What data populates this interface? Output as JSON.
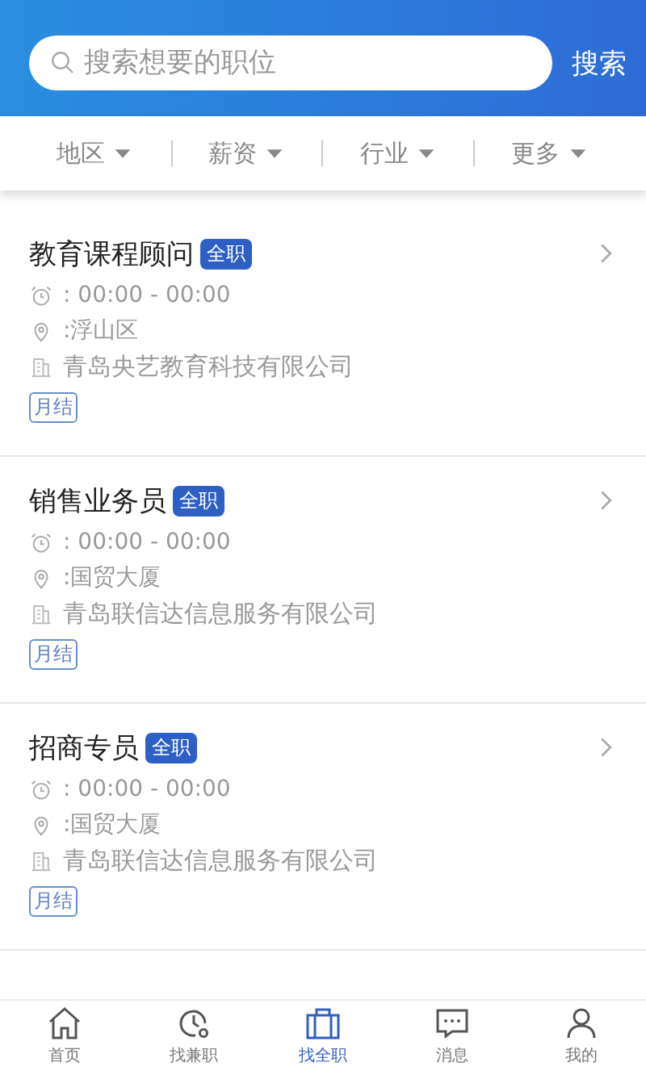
{
  "search": {
    "placeholder": "搜索想要的职位",
    "button": "搜索"
  },
  "filters": [
    {
      "label": "地区"
    },
    {
      "label": "薪资"
    },
    {
      "label": "行业"
    },
    {
      "label": "更多"
    }
  ],
  "jobs": [
    {
      "title": "教育课程顾问",
      "type": "全职",
      "hours": ": 00:00 - 00:00",
      "location": ":浮山区",
      "company": "青岛央艺教育科技有限公司",
      "pay": "月结"
    },
    {
      "title": "销售业务员",
      "type": "全职",
      "hours": ": 00:00 - 00:00",
      "location": ":国贸大厦",
      "company": "青岛联信达信息服务有限公司",
      "pay": "月结"
    },
    {
      "title": "招商专员",
      "type": "全职",
      "hours": ": 00:00 - 00:00",
      "location": ":国贸大厦",
      "company": "青岛联信达信息服务有限公司",
      "pay": "月结"
    }
  ],
  "tabs": [
    {
      "label": "首页",
      "selected": false
    },
    {
      "label": "找兼职",
      "selected": false
    },
    {
      "label": "找全职",
      "selected": true
    },
    {
      "label": "消息",
      "selected": false
    },
    {
      "label": "我的",
      "selected": false
    }
  ]
}
